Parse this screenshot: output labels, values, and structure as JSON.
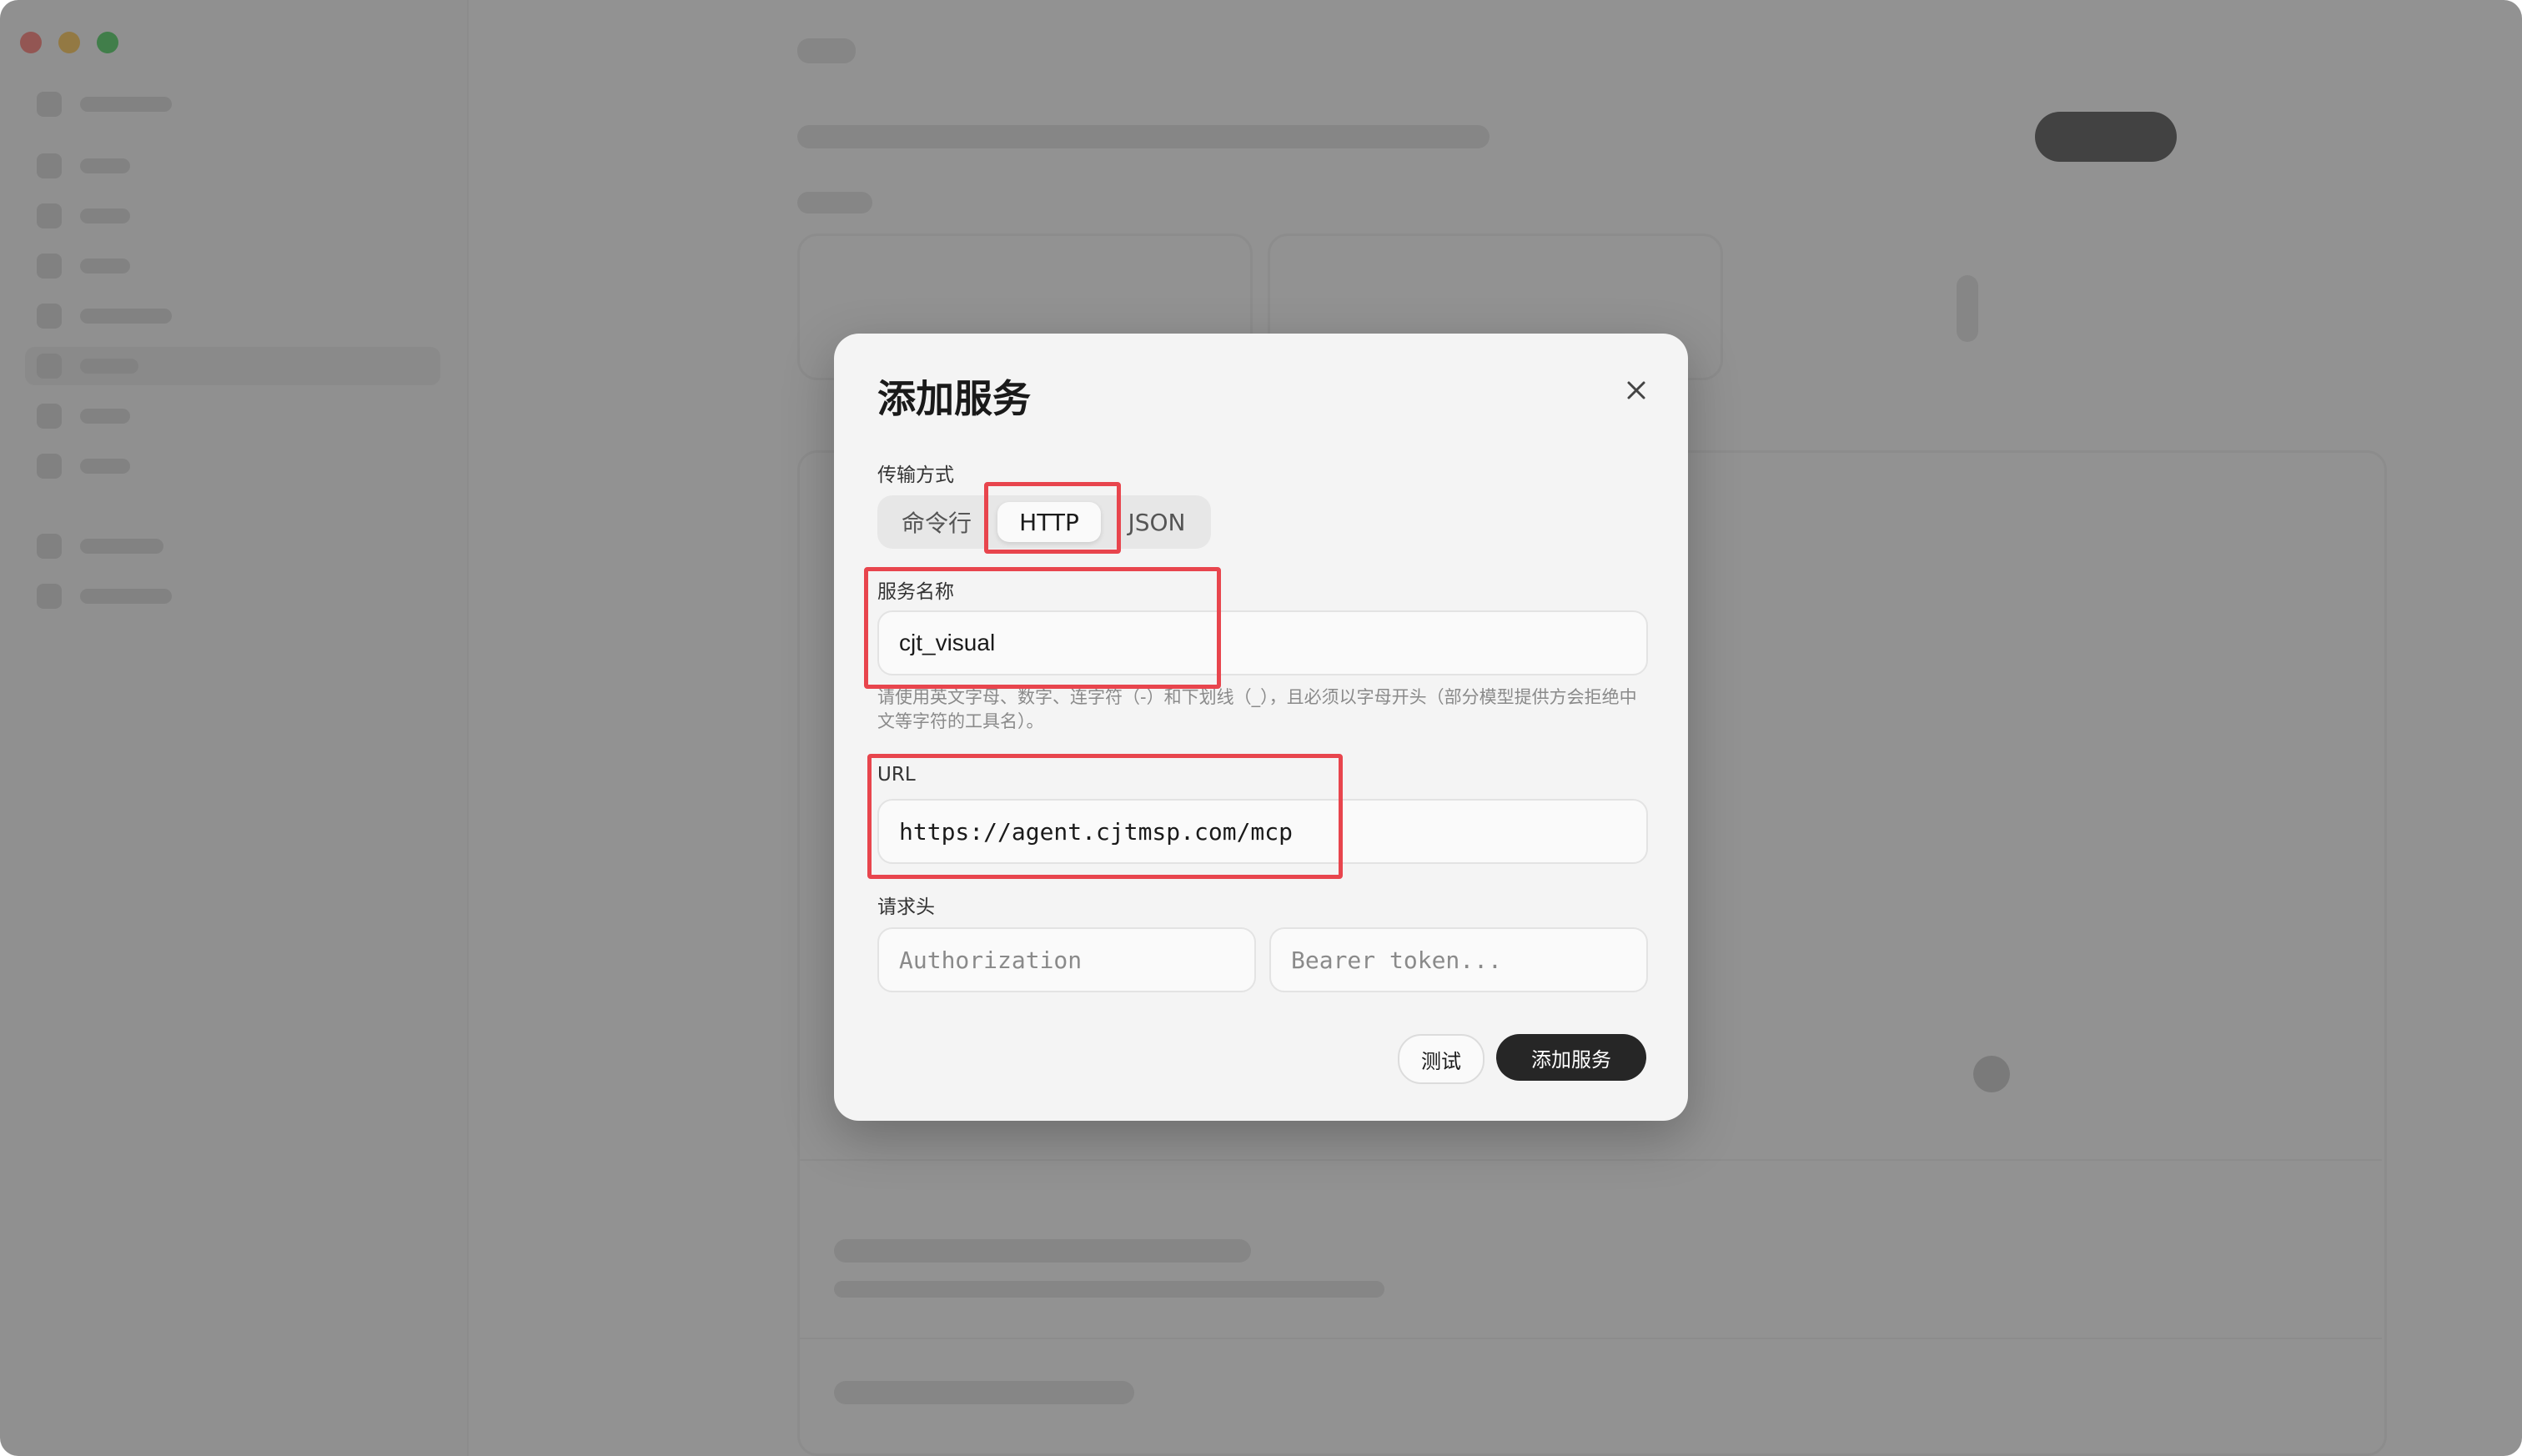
{
  "modal": {
    "title": "添加服务",
    "transport_label": "传输方式",
    "transport_options": [
      "命令行",
      "HTTP",
      "JSON"
    ],
    "transport_selected": "HTTP",
    "service_name_label": "服务名称",
    "service_name_value": "cjt_visual",
    "service_name_helper": "请使用英文字母、数字、连字符（-）和下划线（_），且必须以字母开头（部分模型提供方会拒绝中文等字符的工具名）。",
    "url_label": "URL",
    "url_value": "https://agent.cjtmsp.com/mcp",
    "headers_label": "请求头",
    "header_key_placeholder": "Authorization",
    "header_value_placeholder": "Bearer token...",
    "test_button": "测试",
    "add_button": "添加服务"
  },
  "icons": {
    "close": "close-icon"
  },
  "colors": {
    "annotation": "#e8454d",
    "primary_button": "#262626"
  }
}
